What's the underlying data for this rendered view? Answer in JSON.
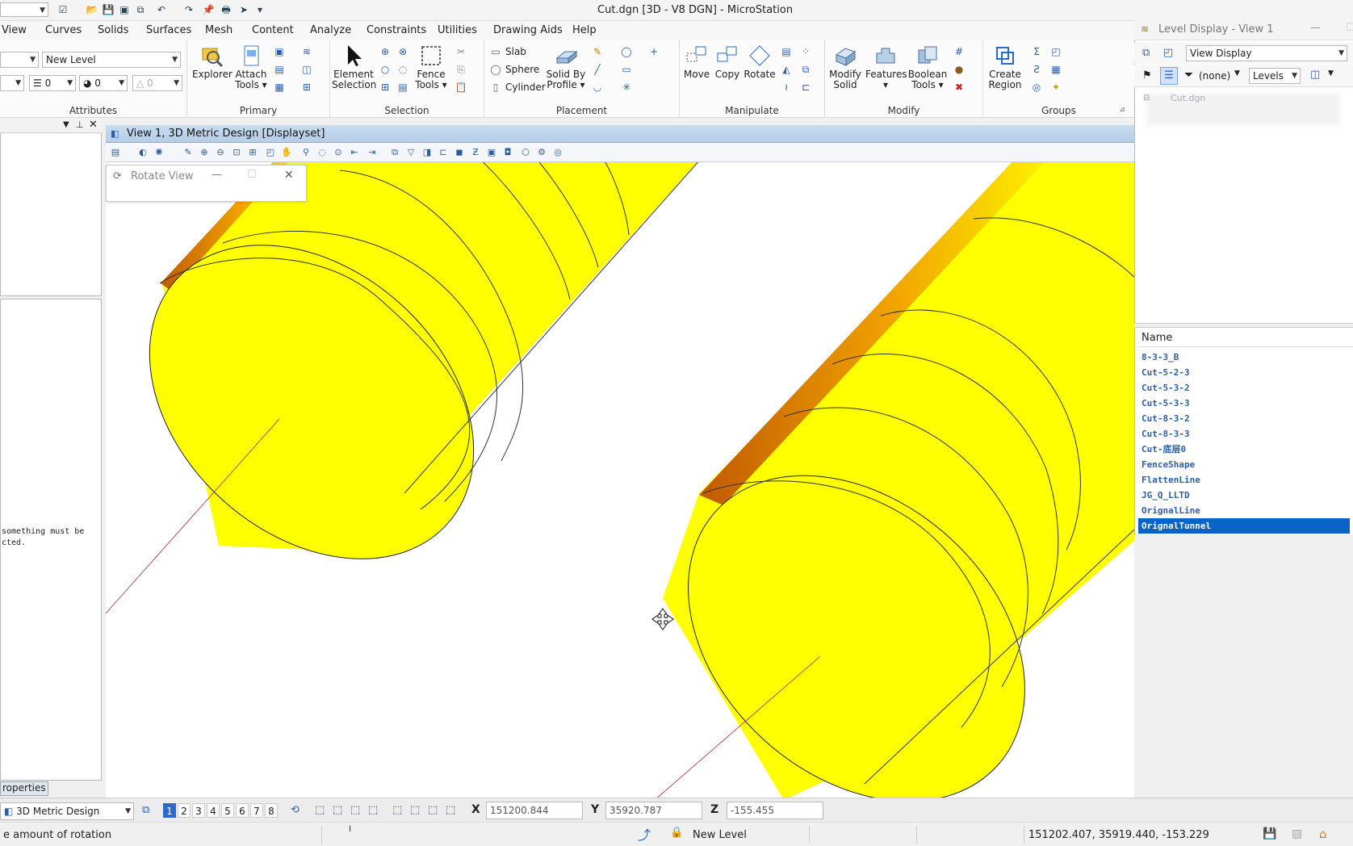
{
  "window": {
    "title": "Cut.dgn [3D - V8 DGN] - MicroStation"
  },
  "menu": [
    "View",
    "Curves",
    "Solids",
    "Surfaces",
    "Mesh",
    "Content",
    "Analyze",
    "Constraints",
    "Utilities",
    "Drawing Aids",
    "Help"
  ],
  "ribbon": {
    "attributes": {
      "label": "Attributes",
      "level": "New Level",
      "weight": "0",
      "color": "0",
      "style": "0"
    },
    "primary": {
      "label": "Primary",
      "explorer": "Explorer",
      "attach": "Attach",
      "tools": "Tools"
    },
    "selection": {
      "label": "Selection",
      "element": "Element",
      "element2": "Selection",
      "fence": "Fence",
      "fence2": "Tools"
    },
    "placement": {
      "label": "Placement",
      "slab": "Slab",
      "sphere": "Sphere",
      "cylinder": "Cylinder",
      "solidby": "Solid By",
      "profile": "Profile"
    },
    "manipulate": {
      "label": "Manipulate",
      "move": "Move",
      "copy": "Copy",
      "rotate": "Rotate"
    },
    "modify": {
      "label": "Modify",
      "modify1": "Modify",
      "modify2": "Solid",
      "features": "Features",
      "boolean1": "Boolean",
      "boolean2": "Tools"
    },
    "groups": {
      "label": "Groups",
      "create1": "Create",
      "create2": "Region"
    }
  },
  "left_panel": {
    "message": "something must be\ncted.",
    "tab": "roperties"
  },
  "view": {
    "title": "View 1, 3D Metric Design [Displayset]"
  },
  "rotate_dialog": {
    "title": "Rotate View"
  },
  "level_display": {
    "title": "Level Display - View 1",
    "mode": "View Display",
    "filter": "(none)",
    "type": "Levels",
    "tree_root": "Cut.dgn",
    "column": "Name",
    "levels": [
      "8-3-3_B",
      "Cut-5-2-3",
      "Cut-5-3-2",
      "Cut-5-3-3",
      "Cut-8-3-2",
      "Cut-8-3-3",
      "Cut-底层0",
      "FenceShape",
      "FlattenLine",
      "JG_Q_LLTD",
      "OrignalLine",
      "OrignalTunnel"
    ],
    "selected": "OrignalTunnel"
  },
  "bottom": {
    "model": "3D Metric Design",
    "views": [
      "1",
      "2",
      "3",
      "4",
      "5",
      "6",
      "7",
      "8"
    ],
    "x_label": "X",
    "x": "151200.844",
    "y_label": "Y",
    "y": "35920.787",
    "z_label": "Z",
    "z": "-155.455",
    "prompt": "e amount of rotation",
    "level": "New Level",
    "cursor": "151202.407, 35919.440, -153.229"
  },
  "colors": {
    "solid": "#ffff00",
    "shade": "#d86a00",
    "selection": "#0a64c8",
    "view_title": "#c9dcf0"
  }
}
